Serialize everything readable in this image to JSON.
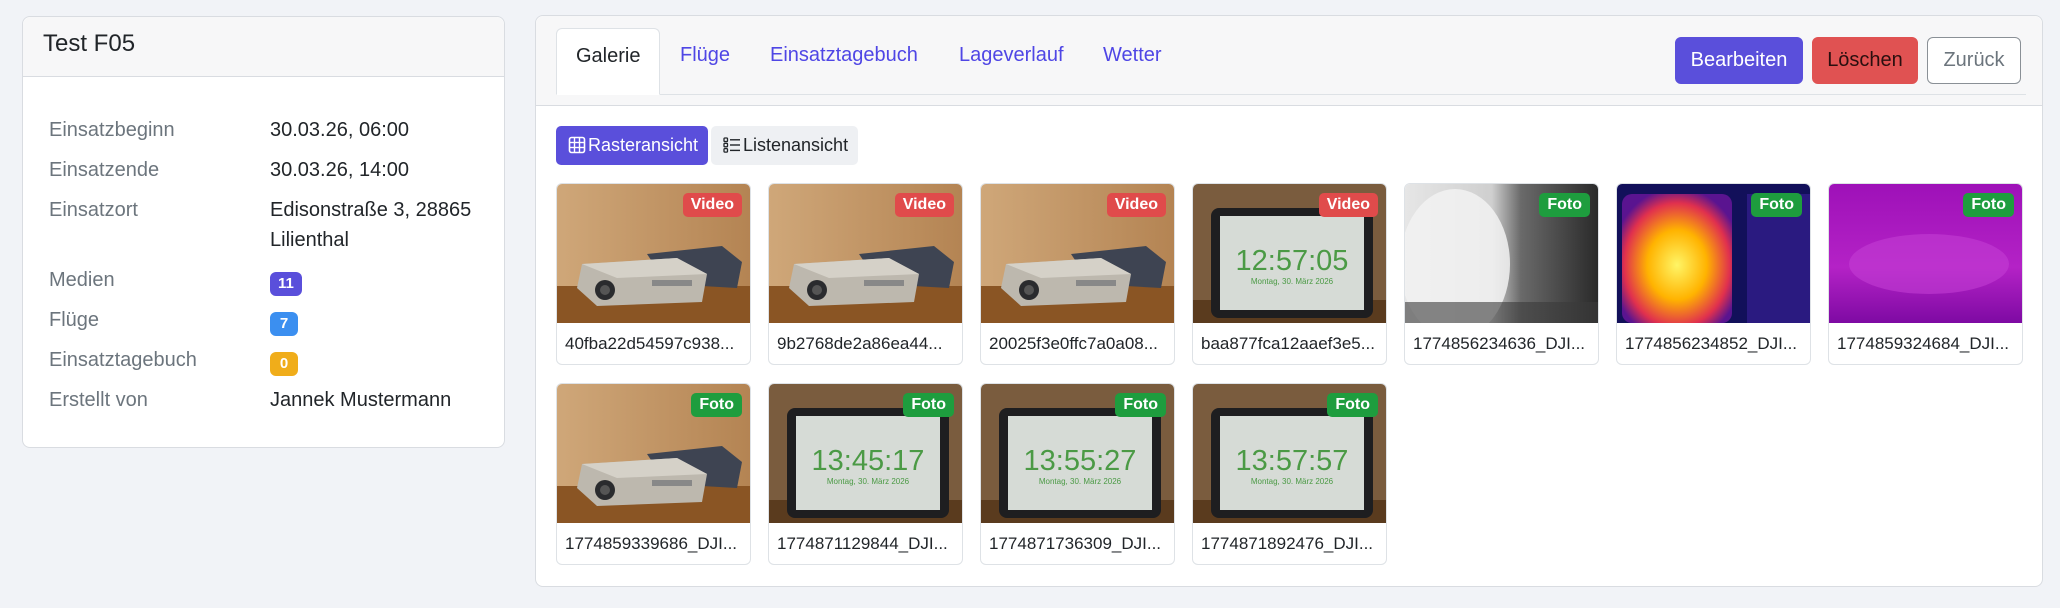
{
  "mission": {
    "title": "Test F05",
    "fields": [
      {
        "label": "Einsatzbeginn",
        "value": "30.03.26, 06:00"
      },
      {
        "label": "Einsatzende",
        "value": "30.03.26, 14:00"
      },
      {
        "label": "Einsatzort",
        "value": "Edisonstraße 3, 28865 Lilienthal"
      },
      {
        "label": "Medien",
        "badge": "11",
        "badge_color": "#5a4fdb"
      },
      {
        "label": "Flüge",
        "badge": "7",
        "badge_color": "#3b8ff0"
      },
      {
        "label": "Einsatztagebuch",
        "badge": "0",
        "badge_color": "#f0ad1a"
      },
      {
        "label": "Erstellt von",
        "value": "Jannek Mustermann"
      }
    ]
  },
  "tabs": [
    "Galerie",
    "Flüge",
    "Einsatztagebuch",
    "Lageverlauf",
    "Wetter"
  ],
  "active_tab": "Galerie",
  "actions": {
    "edit": "Bearbeiten",
    "delete": "Löschen",
    "back": "Zurück"
  },
  "view_toggle": {
    "grid": "Rasteransicht",
    "list": "Listenansicht",
    "active": "grid"
  },
  "colors": {
    "accent": "#5a4fdb",
    "danger": "#e05252",
    "video": "#e04b4b",
    "foto": "#1e9d3e"
  },
  "media": [
    {
      "name": "40fba22d54597c938...",
      "type": "Video",
      "thumb": "projector"
    },
    {
      "name": "9b2768de2a86ea44...",
      "type": "Video",
      "thumb": "projector"
    },
    {
      "name": "20025f3e0ffc7a0a08...",
      "type": "Video",
      "thumb": "projector"
    },
    {
      "name": "baa877fca12aaef3e5...",
      "type": "Video",
      "thumb": "tablet",
      "clock": "12:57:05",
      "date": "Montag, 30. März 2026"
    },
    {
      "name": "1774856234636_DJI...",
      "type": "Foto",
      "thumb": "thermal-gray"
    },
    {
      "name": "1774856234852_DJI...",
      "type": "Foto",
      "thumb": "thermal-iron"
    },
    {
      "name": "1774859324684_DJI...",
      "type": "Foto",
      "thumb": "thermal-purple"
    },
    {
      "name": "1774859339686_DJI...",
      "type": "Foto",
      "thumb": "projector"
    },
    {
      "name": "1774871129844_DJI...",
      "type": "Foto",
      "thumb": "tablet",
      "clock": "13:45:17",
      "date": "Montag, 30. März 2026"
    },
    {
      "name": "1774871736309_DJI...",
      "type": "Foto",
      "thumb": "tablet",
      "clock": "13:55:27",
      "date": "Montag, 30. März 2026"
    },
    {
      "name": "1774871892476_DJI...",
      "type": "Foto",
      "thumb": "tablet",
      "clock": "13:57:57",
      "date": "Montag, 30. März 2026"
    }
  ]
}
